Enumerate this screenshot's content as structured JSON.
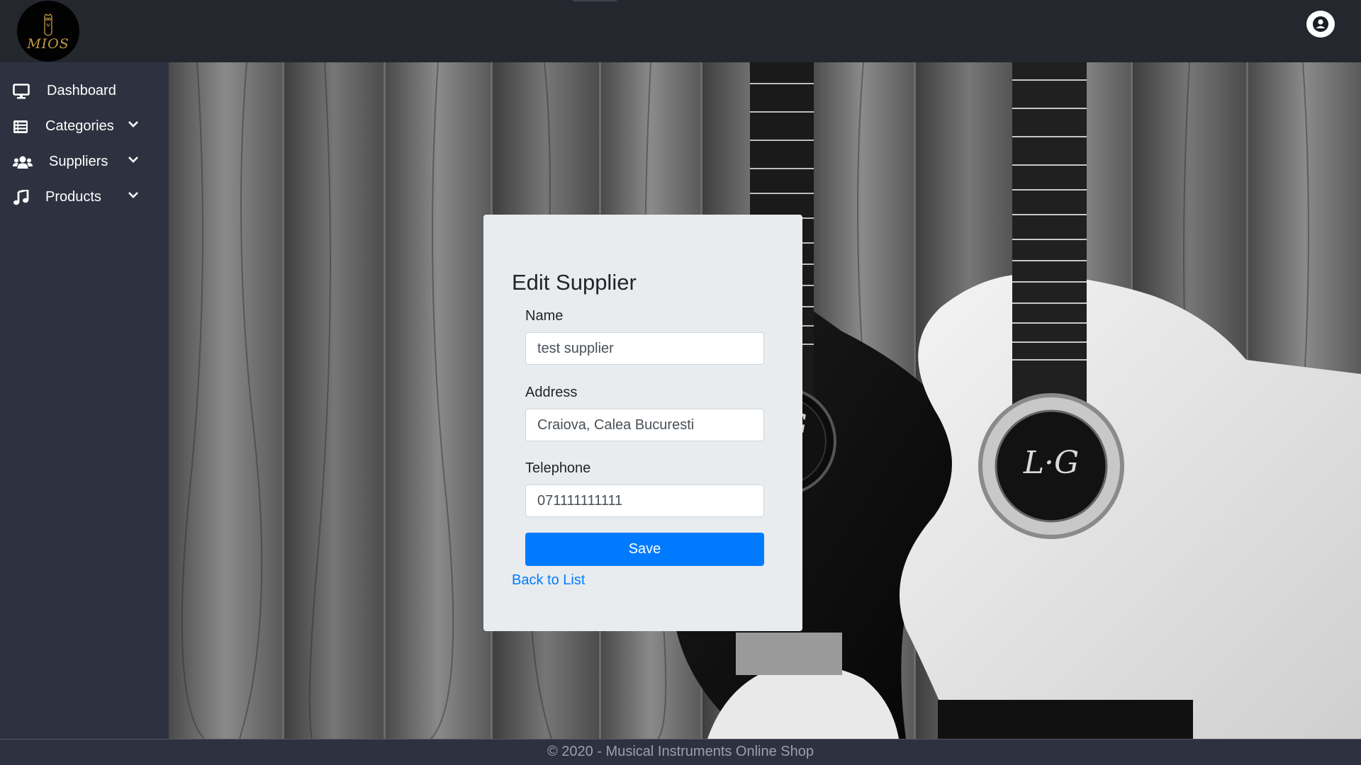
{
  "header": {
    "logo_text": "MIOS",
    "user_icon": "user-circle-icon"
  },
  "sidebar": {
    "items": [
      {
        "label": "Dashboard",
        "icon": "monitor-icon",
        "has_submenu": false
      },
      {
        "label": "Categories",
        "icon": "list-icon",
        "has_submenu": true
      },
      {
        "label": "Suppliers",
        "icon": "users-icon",
        "has_submenu": true
      },
      {
        "label": "Products",
        "icon": "music-note-icon",
        "has_submenu": true
      }
    ]
  },
  "form": {
    "title": "Edit Supplier",
    "name_label": "Name",
    "name_value": "test supplier",
    "address_label": "Address",
    "address_value": "Craiova, Calea Bucuresti",
    "telephone_label": "Telephone",
    "telephone_value": "071111111111",
    "save_label": "Save",
    "back_label": "Back to List"
  },
  "footer": {
    "text": "© 2020 - Musical Instruments Online Shop"
  },
  "colors": {
    "topbar": "#24272e",
    "sidebar": "#2e3240",
    "card": "#e9ecef",
    "primary": "#007bff"
  }
}
